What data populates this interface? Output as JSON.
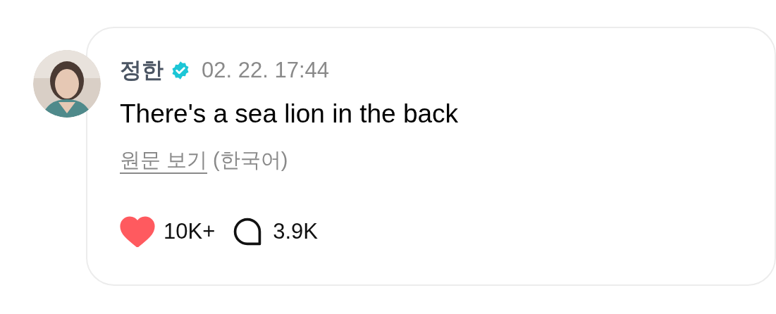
{
  "post": {
    "author": "정한",
    "verified": true,
    "time": "02. 22. 17:44",
    "text": "There's a sea lion in the back",
    "original_link": "원문 보기",
    "original_language": "(한국어)",
    "likes": {
      "liked": true,
      "count": "10K+"
    },
    "comments": {
      "count": "3.9K"
    }
  }
}
